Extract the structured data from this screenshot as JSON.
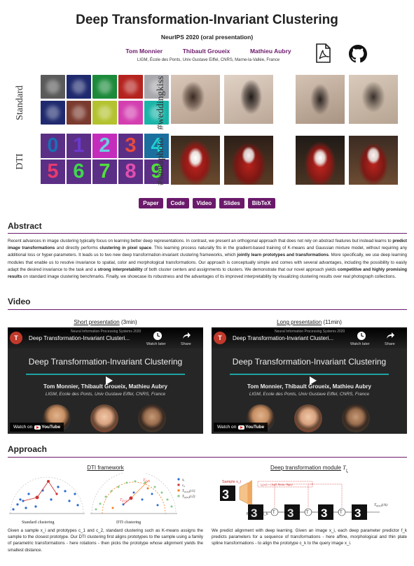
{
  "header": {
    "title": "Deep Transformation-Invariant Clustering",
    "venue": "NeurIPS 2020 (oral presentation)",
    "authors": [
      "Tom Monnier",
      "Thibault Groueix",
      "Mathieu Aubry"
    ],
    "affiliation": "LIGM, École des Ponts, Univ Gustave Eiffel, CNRS, Marne-la-Vallée, France",
    "icons": [
      "pdf-icon",
      "github-icon"
    ]
  },
  "teaser": {
    "row_labels": [
      "Standard",
      "DTI"
    ],
    "photo_labels": [
      "#weddingkiss",
      "#santaphoto"
    ],
    "dti_digits": [
      "0",
      "1",
      "2",
      "3",
      "4",
      "5",
      "6",
      "7",
      "8",
      "9"
    ],
    "colors": {
      "standard_bg": [
        "#5a5a5a",
        "#1f2a6e",
        "#1b8a3a",
        "#b5231e",
        "#a8a8ad",
        "#1f2a6e",
        "#7a3a2e",
        "#b3c22e",
        "#d43fb0",
        "#19b5a8"
      ],
      "dti_bg": [
        "#5b2f86",
        "#5b2f86",
        "#c42dbb",
        "#5b2f86",
        "#1a6f9e",
        "#5b2f86",
        "#5b2f86",
        "#5b2f86",
        "#5b2f86",
        "#5b2f86"
      ],
      "dti_fg": [
        "#1a6fb5",
        "#6b3ad0",
        "#6ad0e0",
        "#e84c3d",
        "#1fd0d0",
        "#e83a6f",
        "#3fd84b",
        "#4fe03a",
        "#e04fb0",
        "#4fe03a"
      ]
    }
  },
  "buttons": [
    "Paper",
    "Code",
    "Video",
    "Slides",
    "BibTeX"
  ],
  "sections": {
    "abstract": "Abstract",
    "video": "Video",
    "approach": "Approach"
  },
  "abstract": {
    "p1": "Recent advances in image clustering typically focus on learning better deep representations. In contrast, we present an orthogonal approach that does not rely on abstract features but instead learns to ",
    "b1": "predict image transformations",
    "p2": " and directly performs ",
    "b2": "clustering in pixel space",
    "p3": ". This learning process naturally fits in the gradient-based training of K-means and Gaussian mixture model, without requiring any additional loss or hyper-parameters. It leads us to two new deep transformation-invariant clustering frameworks, which ",
    "b3": "jointly learn prototypes and transformations",
    "p4": ". More specifically, we use deep learning modules that enable us to resolve invariance to spatial, color and morphological transformations. Our approach is conceptually simple and comes with several advantages, including the possibility to easily adapt the desired invariance to the task and a ",
    "b4": "strong interpretability",
    "p5": " of both cluster centers and assignments to clusters. We demonstrate that our novel approach yields ",
    "b5": "competitive and highly promising results",
    "p6": " on standard image clustering benchmarks. Finally, we showcase its robustness and the advantages of its improved interpretability by visualizing clustering results over real photograph collections."
  },
  "video": {
    "left": {
      "link": "Short presentation",
      "duration": " (3min)"
    },
    "right": {
      "link": "Long presentation",
      "duration": " (11min)"
    },
    "card": {
      "channel_initial": "T",
      "title": "Deep Transformation-Invariant Clusteri...",
      "overlay_sub": "Neural Information Processing Systems 2020",
      "watch_later": "Watch later",
      "share": "Share",
      "heading": "Deep Transformation-Invariant Clustering",
      "names": "Tom Monnier, Thibault Groueix, Mathieu Aubry",
      "lab": "LIGM, Ecole des Ponts, Univ Gustave Eiffel, CNRS, France",
      "watch_on": "Watch on",
      "youtube": "YouTube"
    }
  },
  "approach": {
    "left": {
      "link": "DTI framework",
      "fig_labels": [
        "Standard clustering",
        "DTI clustering"
      ],
      "legend": [
        "x_i",
        "c_k",
        "T_f_k(x_i)(c_1)",
        "T_f_k(x_i)(c_2)"
      ],
      "text": "Given a sample x_i and prototypes c_1 and c_2, standard clustering such as K-means assigns the sample to the closest prototype. Our DTI clustering first aligns prototypes to the sample using a family of parametric transformations - here rotations - then picks the prototype whose alignment yields the smallest distance."
    },
    "right": {
      "link": "Deep transformation module",
      "link_math": "T_f_k",
      "fig_labels": [
        "Sample x_i",
        "Prototype c_k"
      ],
      "text": "We predict alignment with deep learning. Given an image x_i, each deep parameter predictor f_k predicts parameters for a sequence of transformations - here affine, morphological and thin plate spline transformations - to align the prototype c_k to the query image x_i."
    }
  }
}
